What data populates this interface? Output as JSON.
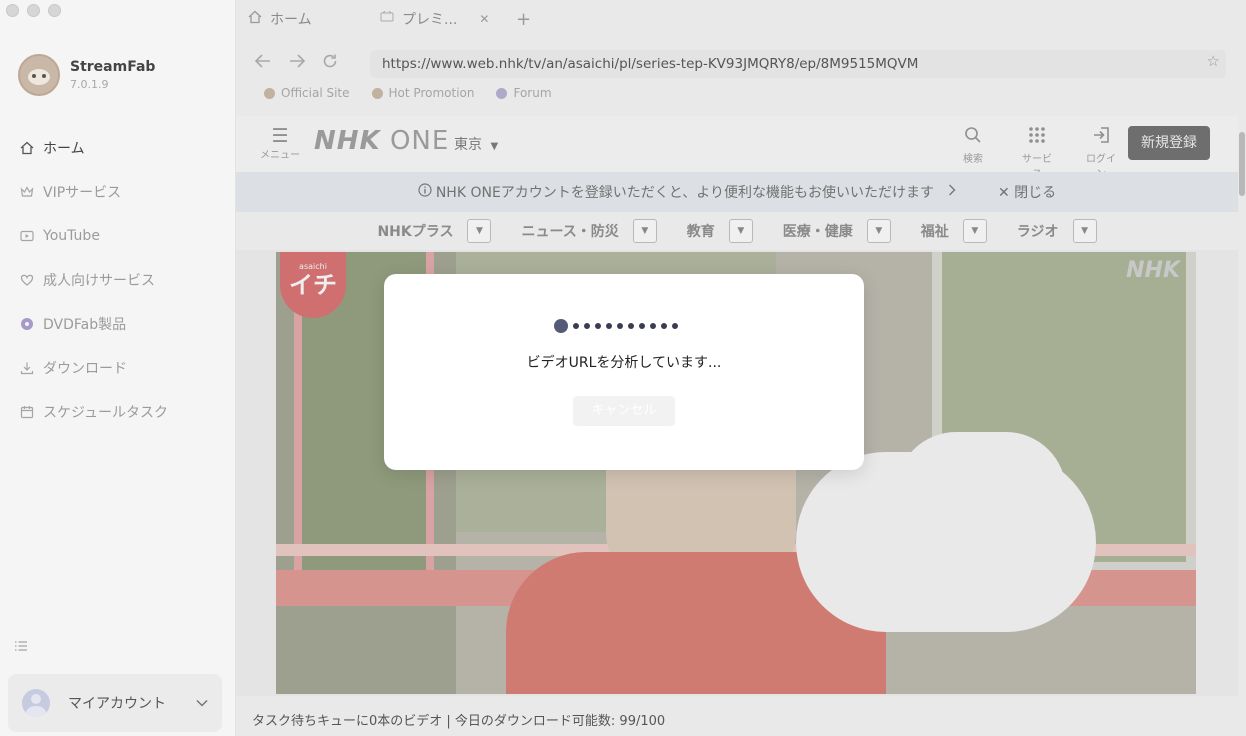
{
  "app": {
    "name": "StreamFab",
    "version": "7.0.1.9"
  },
  "sidebar": {
    "items": [
      {
        "label": "ホーム",
        "icon": "home-icon"
      },
      {
        "label": "VIPサービス",
        "icon": "crown-icon"
      },
      {
        "label": "YouTube",
        "icon": "youtube-icon"
      },
      {
        "label": "成人向けサービス",
        "icon": "heart-icon"
      },
      {
        "label": "DVDFab製品",
        "icon": "dvdfab-icon"
      },
      {
        "label": "ダウンロード",
        "icon": "download-icon"
      },
      {
        "label": "スケジュールタスク",
        "icon": "calendar-icon"
      }
    ],
    "account_label": "マイアカウント"
  },
  "browser": {
    "tabs": [
      {
        "label": "ホーム"
      },
      {
        "label": "プレミ..."
      }
    ],
    "url": "https://www.web.nhk/tv/an/asaichi/pl/series-tep-KV93JMQRY8/ep/8M9515MQVM",
    "bookmarks": [
      {
        "label": "Official Site"
      },
      {
        "label": "Hot Promotion"
      },
      {
        "label": "Forum"
      }
    ]
  },
  "web": {
    "menu_label": "メニュー",
    "logo_nhk": "NHK",
    "logo_one": "ONE",
    "region": "東京",
    "header_icons": [
      {
        "label": "検索",
        "icon": "search-icon"
      },
      {
        "label": "サービス",
        "icon": "grid-icon"
      },
      {
        "label": "ログイン",
        "icon": "login-icon"
      }
    ],
    "signup_label": "新規登録",
    "notice_text": "NHK ONEアカウントを登録いただくと、より便利な機能もお使いいただけます",
    "notice_close": "閉じる",
    "categories": [
      {
        "label": "NHKプラス"
      },
      {
        "label": "ニュース・防災"
      },
      {
        "label": "教育"
      },
      {
        "label": "医療・健康"
      },
      {
        "label": "福祉"
      },
      {
        "label": "ラジオ"
      }
    ],
    "video_badge_small": "asaichi",
    "video_badge_big": "イチ",
    "video_watermark": "NHK"
  },
  "status_bar": "タスク待ちキューに0本のビデオ | 今日のダウンロード可能数: 99/100",
  "modal": {
    "message": "ビデオURLを分析しています...",
    "cancel_label": "キャンセル"
  }
}
